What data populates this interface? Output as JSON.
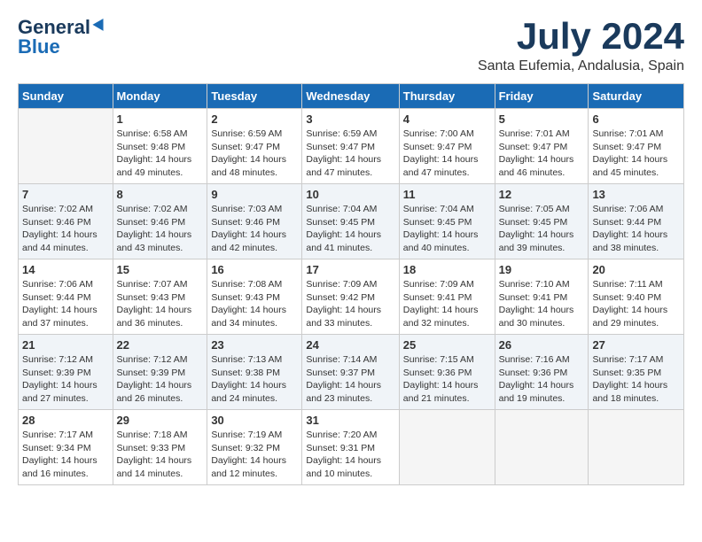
{
  "header": {
    "logo_line1": "General",
    "logo_line2": "Blue",
    "month": "July 2024",
    "location": "Santa Eufemia, Andalusia, Spain"
  },
  "weekdays": [
    "Sunday",
    "Monday",
    "Tuesday",
    "Wednesday",
    "Thursday",
    "Friday",
    "Saturday"
  ],
  "weeks": [
    [
      {
        "day": "",
        "info": ""
      },
      {
        "day": "1",
        "info": "Sunrise: 6:58 AM\nSunset: 9:48 PM\nDaylight: 14 hours\nand 49 minutes."
      },
      {
        "day": "2",
        "info": "Sunrise: 6:59 AM\nSunset: 9:47 PM\nDaylight: 14 hours\nand 48 minutes."
      },
      {
        "day": "3",
        "info": "Sunrise: 6:59 AM\nSunset: 9:47 PM\nDaylight: 14 hours\nand 47 minutes."
      },
      {
        "day": "4",
        "info": "Sunrise: 7:00 AM\nSunset: 9:47 PM\nDaylight: 14 hours\nand 47 minutes."
      },
      {
        "day": "5",
        "info": "Sunrise: 7:01 AM\nSunset: 9:47 PM\nDaylight: 14 hours\nand 46 minutes."
      },
      {
        "day": "6",
        "info": "Sunrise: 7:01 AM\nSunset: 9:47 PM\nDaylight: 14 hours\nand 45 minutes."
      }
    ],
    [
      {
        "day": "7",
        "info": "Sunrise: 7:02 AM\nSunset: 9:46 PM\nDaylight: 14 hours\nand 44 minutes."
      },
      {
        "day": "8",
        "info": "Sunrise: 7:02 AM\nSunset: 9:46 PM\nDaylight: 14 hours\nand 43 minutes."
      },
      {
        "day": "9",
        "info": "Sunrise: 7:03 AM\nSunset: 9:46 PM\nDaylight: 14 hours\nand 42 minutes."
      },
      {
        "day": "10",
        "info": "Sunrise: 7:04 AM\nSunset: 9:45 PM\nDaylight: 14 hours\nand 41 minutes."
      },
      {
        "day": "11",
        "info": "Sunrise: 7:04 AM\nSunset: 9:45 PM\nDaylight: 14 hours\nand 40 minutes."
      },
      {
        "day": "12",
        "info": "Sunrise: 7:05 AM\nSunset: 9:45 PM\nDaylight: 14 hours\nand 39 minutes."
      },
      {
        "day": "13",
        "info": "Sunrise: 7:06 AM\nSunset: 9:44 PM\nDaylight: 14 hours\nand 38 minutes."
      }
    ],
    [
      {
        "day": "14",
        "info": "Sunrise: 7:06 AM\nSunset: 9:44 PM\nDaylight: 14 hours\nand 37 minutes."
      },
      {
        "day": "15",
        "info": "Sunrise: 7:07 AM\nSunset: 9:43 PM\nDaylight: 14 hours\nand 36 minutes."
      },
      {
        "day": "16",
        "info": "Sunrise: 7:08 AM\nSunset: 9:43 PM\nDaylight: 14 hours\nand 34 minutes."
      },
      {
        "day": "17",
        "info": "Sunrise: 7:09 AM\nSunset: 9:42 PM\nDaylight: 14 hours\nand 33 minutes."
      },
      {
        "day": "18",
        "info": "Sunrise: 7:09 AM\nSunset: 9:41 PM\nDaylight: 14 hours\nand 32 minutes."
      },
      {
        "day": "19",
        "info": "Sunrise: 7:10 AM\nSunset: 9:41 PM\nDaylight: 14 hours\nand 30 minutes."
      },
      {
        "day": "20",
        "info": "Sunrise: 7:11 AM\nSunset: 9:40 PM\nDaylight: 14 hours\nand 29 minutes."
      }
    ],
    [
      {
        "day": "21",
        "info": "Sunrise: 7:12 AM\nSunset: 9:39 PM\nDaylight: 14 hours\nand 27 minutes."
      },
      {
        "day": "22",
        "info": "Sunrise: 7:12 AM\nSunset: 9:39 PM\nDaylight: 14 hours\nand 26 minutes."
      },
      {
        "day": "23",
        "info": "Sunrise: 7:13 AM\nSunset: 9:38 PM\nDaylight: 14 hours\nand 24 minutes."
      },
      {
        "day": "24",
        "info": "Sunrise: 7:14 AM\nSunset: 9:37 PM\nDaylight: 14 hours\nand 23 minutes."
      },
      {
        "day": "25",
        "info": "Sunrise: 7:15 AM\nSunset: 9:36 PM\nDaylight: 14 hours\nand 21 minutes."
      },
      {
        "day": "26",
        "info": "Sunrise: 7:16 AM\nSunset: 9:36 PM\nDaylight: 14 hours\nand 19 minutes."
      },
      {
        "day": "27",
        "info": "Sunrise: 7:17 AM\nSunset: 9:35 PM\nDaylight: 14 hours\nand 18 minutes."
      }
    ],
    [
      {
        "day": "28",
        "info": "Sunrise: 7:17 AM\nSunset: 9:34 PM\nDaylight: 14 hours\nand 16 minutes."
      },
      {
        "day": "29",
        "info": "Sunrise: 7:18 AM\nSunset: 9:33 PM\nDaylight: 14 hours\nand 14 minutes."
      },
      {
        "day": "30",
        "info": "Sunrise: 7:19 AM\nSunset: 9:32 PM\nDaylight: 14 hours\nand 12 minutes."
      },
      {
        "day": "31",
        "info": "Sunrise: 7:20 AM\nSunset: 9:31 PM\nDaylight: 14 hours\nand 10 minutes."
      },
      {
        "day": "",
        "info": ""
      },
      {
        "day": "",
        "info": ""
      },
      {
        "day": "",
        "info": ""
      }
    ]
  ]
}
